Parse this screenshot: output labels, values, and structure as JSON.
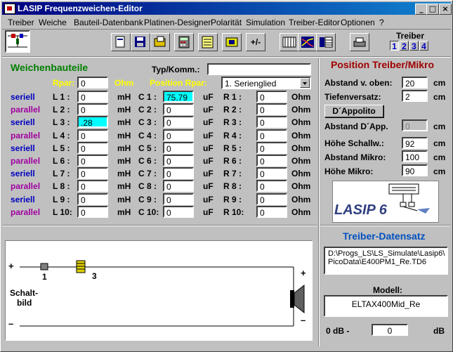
{
  "window": {
    "title": "LASIP  Frequenzweichen-Editor",
    "controls": [
      "_",
      "□",
      "×"
    ]
  },
  "menu": [
    "Treiber",
    "Weiche",
    "Bauteil-Datenbank",
    "Platinen-Designer",
    "Polarität",
    "Simulation",
    "Treiber-Editor",
    "Optionen",
    "?"
  ],
  "toolbar": {
    "polarity_label": "+/-",
    "treiber_label": "Treiber",
    "treiber_tabs": [
      "1",
      "2",
      "3",
      "4"
    ]
  },
  "weichen": {
    "heading": "Weichenbauteile",
    "typ_label": "Typ/Komm.:",
    "typ_value": "",
    "rpar_label": "Rpar:",
    "rpar_value": "0",
    "rpar_unit": "Ohm",
    "pos_rpar_label": "Position Rpar:",
    "pos_rpar_value": "1. Serienglied",
    "rows": [
      {
        "type": "seriell",
        "L": "L 1 :",
        "Lv": "0",
        "C": "C 1 :",
        "Cv": "75.79",
        "R": "R 1 :",
        "Rv": "0"
      },
      {
        "type": "parallel",
        "L": "L 2 :",
        "Lv": "0",
        "C": "C 2 :",
        "Cv": "0",
        "R": "R 2 :",
        "Rv": "0"
      },
      {
        "type": "seriell",
        "L": "L 3 :",
        "Lv": ".28",
        "C": "C 3 :",
        "Cv": "0",
        "R": "R 3 :",
        "Rv": "0"
      },
      {
        "type": "parallel",
        "L": "L 4 :",
        "Lv": "0",
        "C": "C 4 :",
        "Cv": "0",
        "R": "R 4 :",
        "Rv": "0"
      },
      {
        "type": "seriell",
        "L": "L 5 :",
        "Lv": "0",
        "C": "C 5 :",
        "Cv": "0",
        "R": "R 5 :",
        "Rv": "0"
      },
      {
        "type": "parallel",
        "L": "L 6 :",
        "Lv": "0",
        "C": "C 6 :",
        "Cv": "0",
        "R": "R 6 :",
        "Rv": "0"
      },
      {
        "type": "seriell",
        "L": "L 7 :",
        "Lv": "0",
        "C": "C 7 :",
        "Cv": "0",
        "R": "R 7 :",
        "Rv": "0"
      },
      {
        "type": "parallel",
        "L": "L 8 :",
        "Lv": "0",
        "C": "C 8 :",
        "Cv": "0",
        "R": "R 8 :",
        "Rv": "0"
      },
      {
        "type": "seriell",
        "L": "L 9 :",
        "Lv": "0",
        "C": "C 9 :",
        "Cv": "0",
        "R": "R 9 :",
        "Rv": "0"
      },
      {
        "type": "parallel",
        "L": "L 10:",
        "Lv": "0",
        "C": "C 10:",
        "Cv": "0",
        "R": "R 10:",
        "Rv": "0"
      }
    ],
    "unit_L": "mH",
    "unit_C": "uF",
    "unit_R": "Ohm"
  },
  "schaltbild": {
    "label_line1": "Schalt-",
    "label_line2": "bild",
    "plus": "+",
    "minus": "–",
    "comp1": "1",
    "comp3": "3"
  },
  "position": {
    "heading": "Position Treiber/Mikro",
    "abstand_oben_label": "Abstand v. oben:",
    "abstand_oben_value": "20",
    "tiefenversatz_label": "Tiefenversatz:",
    "tiefenversatz_value": "2",
    "dappolito_button": "D´Appolito",
    "abstand_dapp_label": "Abstand D´App.",
    "abstand_dapp_value": "0",
    "hoehe_schallw_label": "Höhe Schallw.:",
    "hoehe_schallw_value": "92",
    "abstand_mikro_label": "Abstand Mikro:",
    "abstand_mikro_value": "100",
    "hoehe_mikro_label": "Höhe Mikro:",
    "hoehe_mikro_value": "90",
    "unit": "cm",
    "logo_text": "LASIP 6"
  },
  "treiber_datensatz": {
    "heading": "Treiber-Datensatz",
    "path_line1": "D:\\Progs_LS\\LS_Simulate\\Lasip6\\",
    "path_line2": "PicoData\\E400PM1_Re.TD6",
    "modell_label": "Modell:",
    "modell_value": "ELTAX400Mid_Re",
    "db_label": "0 dB -",
    "db_value": "0",
    "db_unit": "dB"
  },
  "colors": {
    "title_start": "#000080",
    "title_end": "#1084d0",
    "green": "#008000",
    "red": "#a00000",
    "blue": "#0050c0",
    "seriell": "#0000c0",
    "parallel": "#a000a0",
    "highlight": "#00ffff",
    "yellow": "#ffff00"
  }
}
